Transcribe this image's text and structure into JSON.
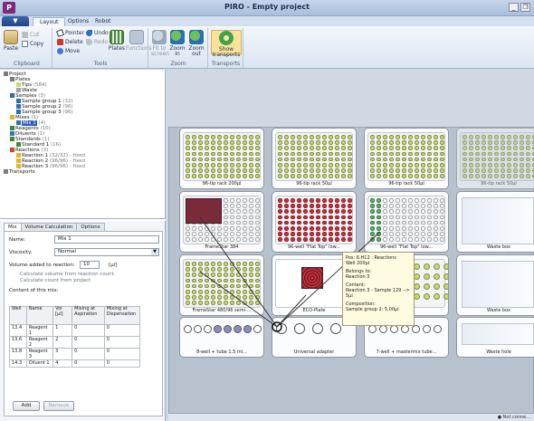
{
  "app": {
    "logo": "P",
    "title": "PIRO - Empty project"
  },
  "window": {
    "minimize": "_",
    "restore": "❐"
  },
  "ribbon_tabs": [
    "Layout",
    "Options",
    "Robot"
  ],
  "ribbon": {
    "clipboard": {
      "paste": "Paste",
      "cut": "Cut",
      "copy": "Copy",
      "label": "Clipboard"
    },
    "tools": {
      "pointer": "Pointer",
      "undo": "Undo",
      "delete": "Delete",
      "redo": "Redo",
      "move": "Move",
      "plates": "Plates",
      "functions": "Functions",
      "label": "Tools"
    },
    "zoom": {
      "fit": "Fit to screen",
      "zoom_in": "Zoom in",
      "zoom_out": "Zoom out",
      "label": "Zoom"
    },
    "transports": {
      "show": "Show transports",
      "label": "Transports"
    }
  },
  "tree": [
    {
      "text": "Project",
      "level": 0
    },
    {
      "text": "Plates",
      "level": 1
    },
    {
      "text": "Tips",
      "count": "(584)",
      "level": 2
    },
    {
      "text": "Waste",
      "level": 2
    },
    {
      "text": "Samples",
      "count": "(3)",
      "level": 1
    },
    {
      "text": "Sample group 1",
      "count": "(32)",
      "level": 2
    },
    {
      "text": "Sample group 2",
      "count": "(96)",
      "level": 2
    },
    {
      "text": "Sample group 3",
      "count": "(96)",
      "level": 2
    },
    {
      "text": "Mixes",
      "count": "(1)",
      "level": 1
    },
    {
      "text": "Mix 1",
      "count": "(4)",
      "level": 2,
      "selected": true
    },
    {
      "text": "Reagents",
      "count": "(10)",
      "level": 1
    },
    {
      "text": "Diluents",
      "count": "(1)",
      "level": 1
    },
    {
      "text": "Standards",
      "count": "(1)",
      "level": 1
    },
    {
      "text": "Standard 1",
      "count": "(16)",
      "level": 2
    },
    {
      "text": "Reactions",
      "count": "(3)",
      "level": 1
    },
    {
      "text": "Reaction 1",
      "count": "(32/32) - fixed",
      "level": 2
    },
    {
      "text": "Reaction 2",
      "count": "(96/96) - fixed",
      "level": 2
    },
    {
      "text": "Reaction 3",
      "count": "(96/96) - fixed",
      "level": 2
    },
    {
      "text": "Transports",
      "level": 0
    }
  ],
  "mix_tabs": [
    "Mix",
    "Volume Calculation",
    "Options"
  ],
  "mix": {
    "name_label": "Name:",
    "name_value": "Mix 1",
    "viscosity_label": "Viscosity:",
    "viscosity_value": "Normal",
    "volume_label": "Volume added to reaction:",
    "volume_value": "10",
    "volume_unit": "[µl]",
    "hint_line1": "Calculate volume from reaction count.",
    "hint_line2": "Calculate count from project",
    "content_label": "Content of this mix:",
    "columns": [
      "Well",
      "Name",
      "Vol [µl]",
      "Mixing at Aspiration",
      "Mixing at Dispensation"
    ],
    "rows": [
      [
        "13.4",
        "Reagent 1",
        "1",
        "0",
        "0"
      ],
      [
        "13.6",
        "Reagent 2",
        "2",
        "0",
        "0"
      ],
      [
        "13.8",
        "Reagent 3",
        "3",
        "0",
        "0"
      ],
      [
        "14.3",
        "Diluent 1",
        "4",
        "0",
        "0"
      ]
    ],
    "add": "Add",
    "remove": "Remove"
  },
  "deck": {
    "slots": {
      "r0c0": "96-tip rack 200µl",
      "r0c1": "96-tip rack 50µl",
      "r0c2": "96-tip rack 50µl",
      "r0c3": "96-tip rack 50µl",
      "r1c0": "FrameStar 384",
      "r1c1": "96-well \"Flat Top\" low...",
      "r1c2": "96-well \"Flat Top\" low...",
      "r1c3": "Waste box",
      "r2c0": "FrameStar 480/96 semi-...",
      "r2c1": "ECO-Plate",
      "r2c2": "tubes",
      "r2c3": "Waste box",
      "r3c0": "8-well + tube 1.5 ml...",
      "r3c1": "Universal adapter",
      "r3c2": "7-well + mastermix tube...",
      "r3c3": "Waste hole"
    }
  },
  "tooltip": {
    "pos": "Pos: 6.H12 : Reactions",
    "well": "Well 200µl",
    "belongs_label": "Belongs to:",
    "belongs_value": "Reaction 3",
    "content_label": "Content:",
    "content_value": "Reaction 3 - Sample 129 --> 5µl",
    "composition_label": "Composition:",
    "composition_value": "Sample group 2: 5,00µl"
  },
  "status": {
    "text": "Not conne..."
  },
  "colors": {
    "tips": "#c9d96a",
    "plate_red": "#d12f3a",
    "plate_dark": "#7a2b3a",
    "green_well": "#5bb36b",
    "brand": "#7b2a7e"
  }
}
